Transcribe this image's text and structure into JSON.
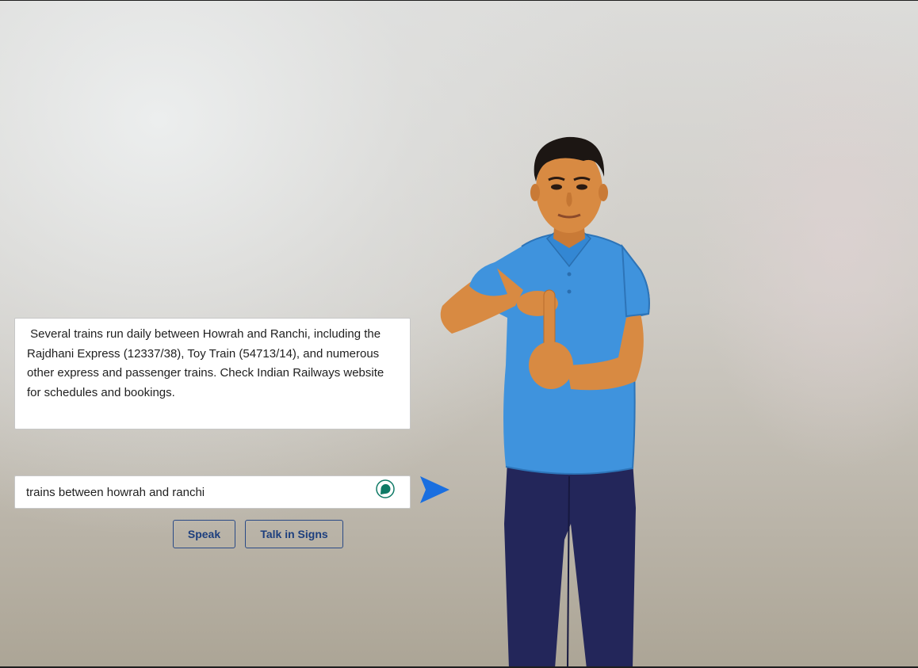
{
  "response": {
    "text": " Several trains run daily between Howrah and Ranchi, including the Rajdhani Express (12337/38), Toy Train (54713/14), and numerous other express and passenger trains. Check Indian Railways website for schedules and bookings."
  },
  "query": {
    "value": "trains between howrah and ranchi"
  },
  "buttons": {
    "speak_label": "Speak",
    "signs_label": "Talk in Signs"
  },
  "icons": {
    "mic": "speech-bubble-icon",
    "send": "send-arrow-icon"
  },
  "colors": {
    "accent": "#1a6fe0",
    "button_text": "#1d3f7e",
    "mic_icon": "#0f7a66",
    "shirt": "#3f93dd",
    "pants": "#23265a",
    "skin": "#d88a42"
  }
}
